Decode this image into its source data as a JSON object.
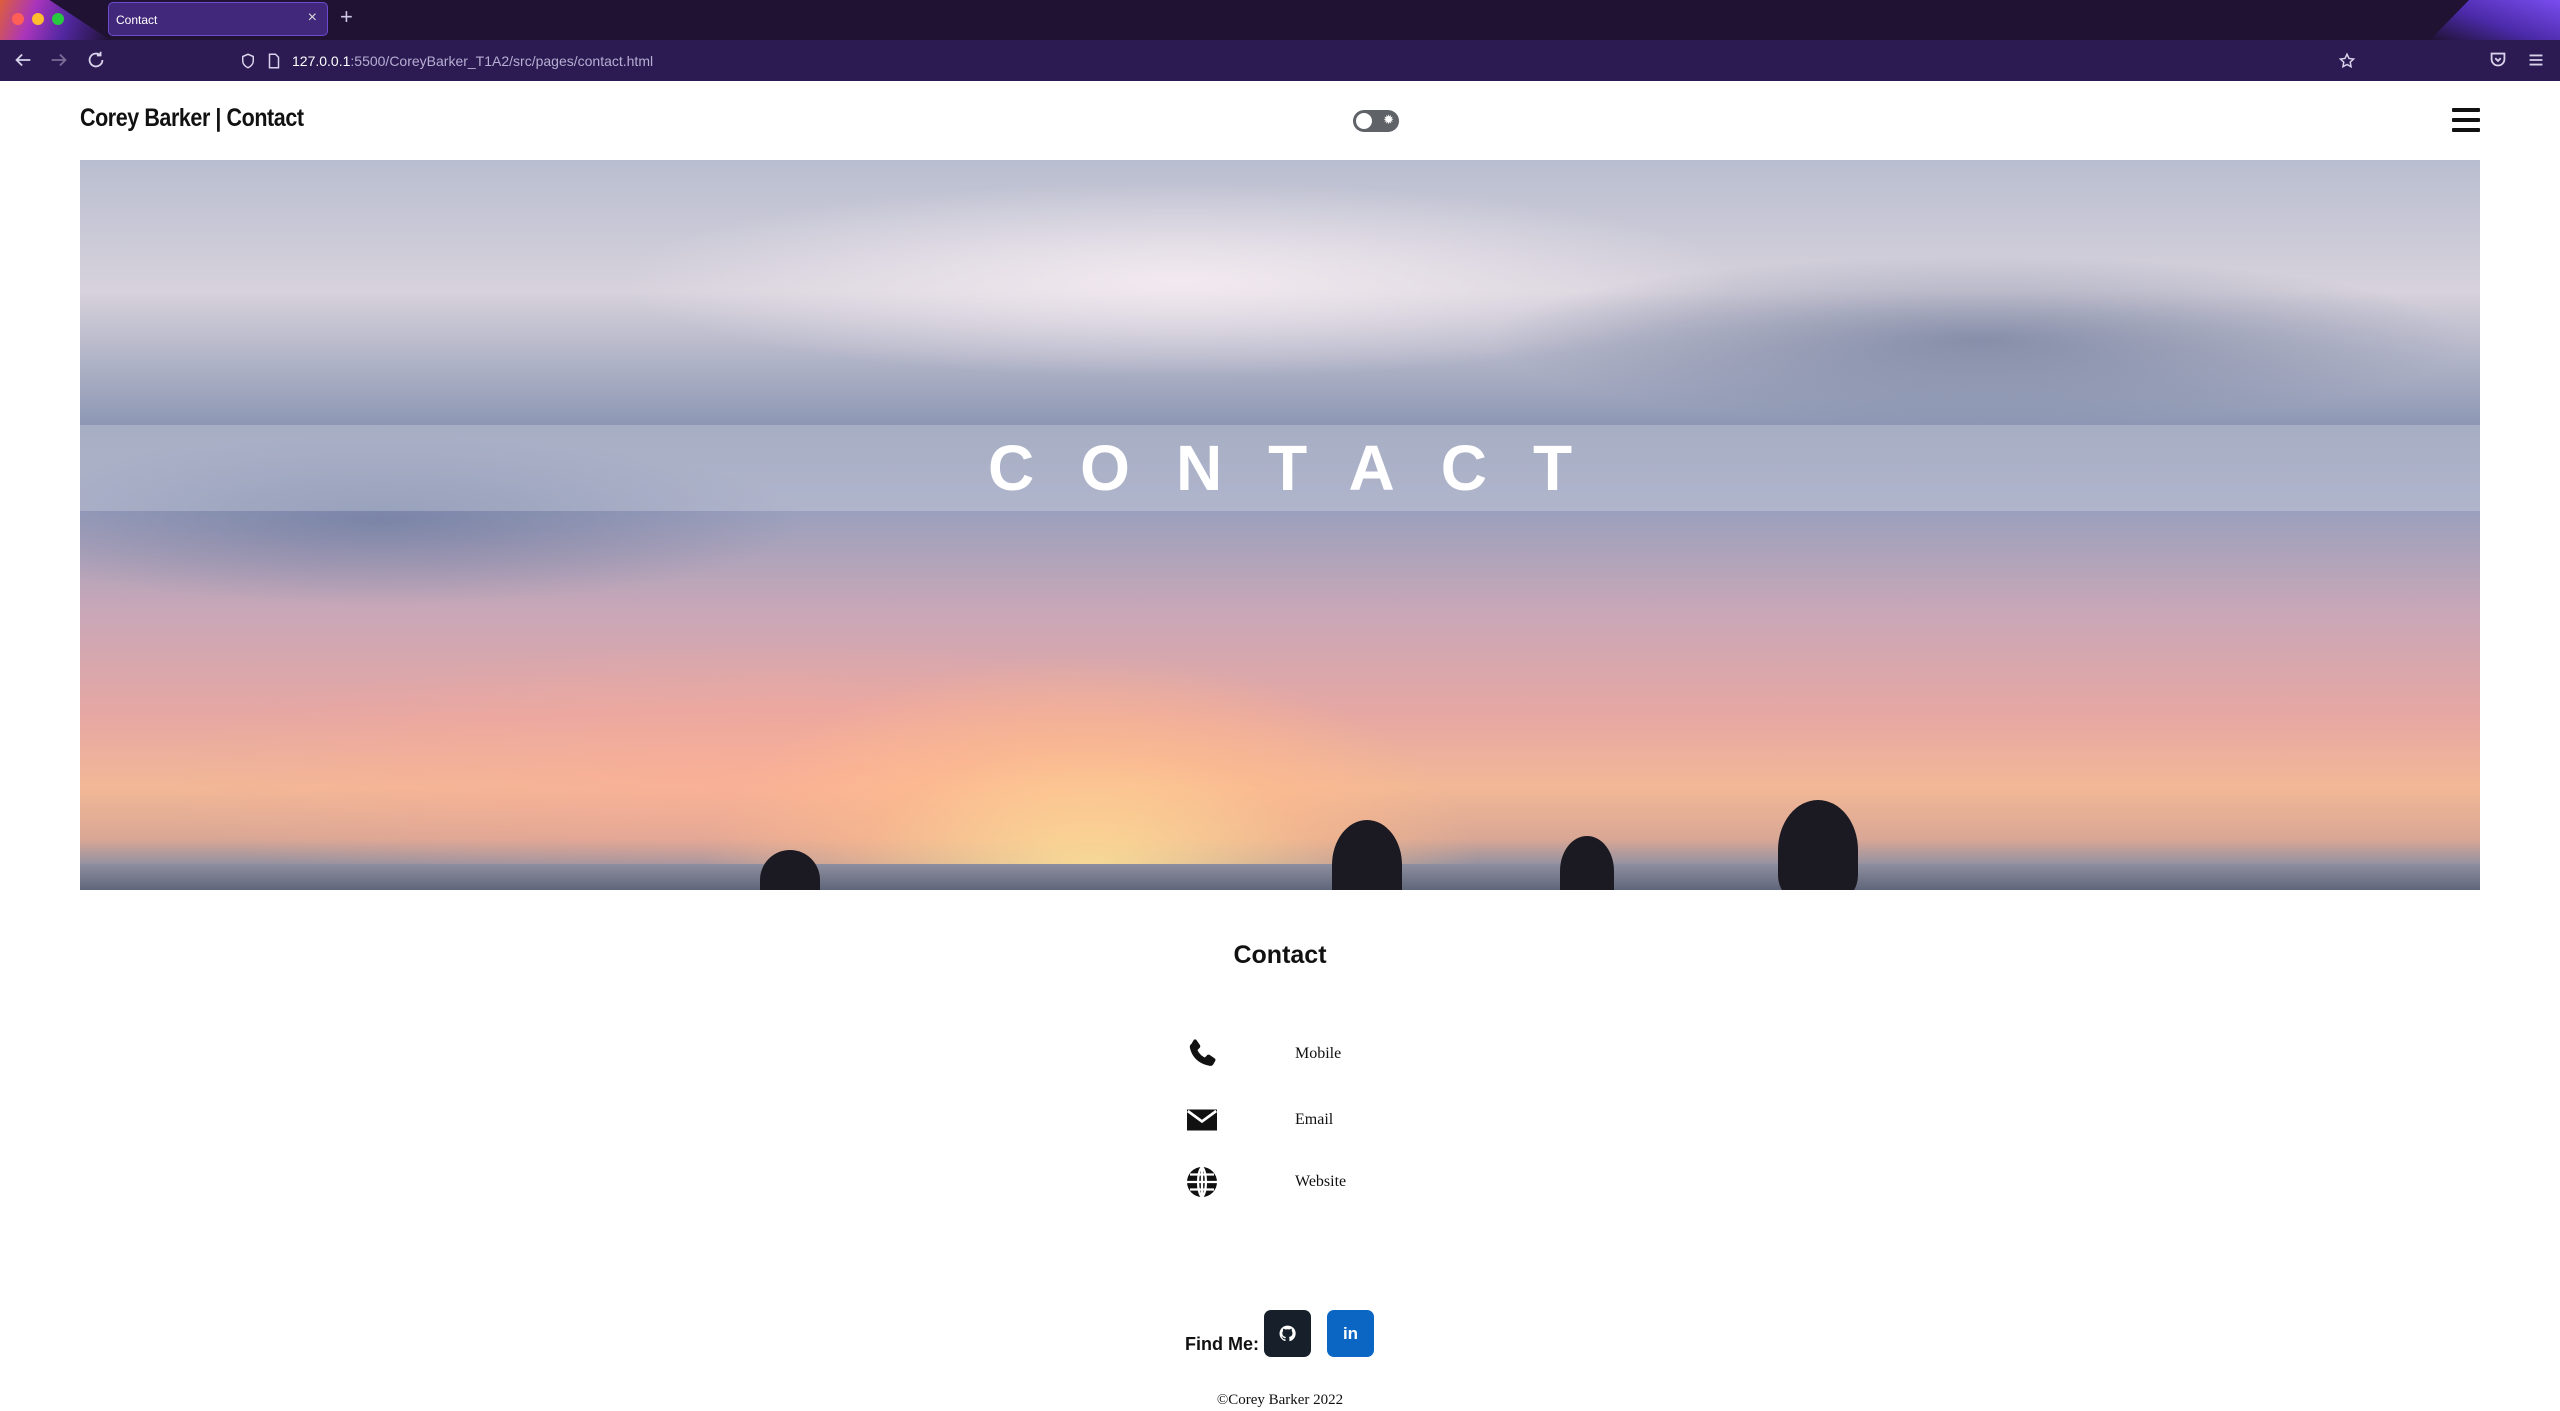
{
  "browser": {
    "tab_title": "Contact",
    "tab_close": "×",
    "new_tab": "+",
    "url_host": "127.0.0.1",
    "url_rest": ":5500/CoreyBarker_T1A2/src/pages/contact.html"
  },
  "header": {
    "site_title": "Corey Barker | Contact",
    "theme_toggle_icon": "sun-icon",
    "menu_icon": "hamburger-icon"
  },
  "hero": {
    "title": "CONTACT"
  },
  "contact": {
    "heading": "Contact",
    "items": [
      {
        "icon": "phone-icon",
        "label": "Mobile"
      },
      {
        "icon": "envelope-icon",
        "label": "Email"
      },
      {
        "icon": "globe-icon",
        "label": "Website"
      }
    ]
  },
  "find_me": {
    "label": "Find Me:",
    "links": [
      {
        "icon": "github-icon",
        "color": "#17202a"
      },
      {
        "icon": "linkedin-icon",
        "text": "in",
        "color": "#0a66c2"
      }
    ]
  },
  "footer": {
    "copyright": "©Corey Barker 2022"
  }
}
